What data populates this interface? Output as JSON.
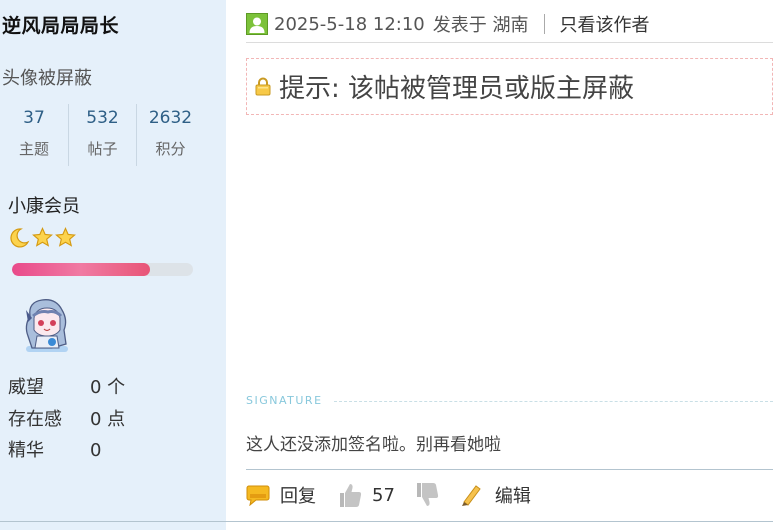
{
  "sidebar": {
    "username": "逆风局局局长",
    "avatar_note": "头像被屏蔽",
    "stats": [
      {
        "value": "37",
        "label": "主题"
      },
      {
        "value": "532",
        "label": "帖子"
      },
      {
        "value": "2632",
        "label": "积分"
      }
    ],
    "group": "小康会员",
    "rank_icons": [
      "moon-icon",
      "star-icon",
      "star-icon"
    ],
    "progress_percent": 76,
    "info": [
      {
        "key": "威望",
        "value": "0 个"
      },
      {
        "key": "存在感",
        "value": "0 点"
      },
      {
        "key": "精华",
        "value": "0"
      }
    ]
  },
  "post": {
    "datetime": "2025-5-18 12:10",
    "posted_in": "发表于 湖南",
    "only_author": "只看该作者",
    "notice": "提示: 该帖被管理员或版主屏蔽",
    "signature_label": "SIGNATURE",
    "signature_text": "这人还没添加签名啦。别再看她啦",
    "actions": {
      "reply": "回复",
      "like_count": "57",
      "edit": "编辑"
    }
  },
  "colors": {
    "sidebar_bg": "#e5f0fa",
    "progress_fill": "#e94a8a",
    "stat_number": "#2e5f86",
    "notice_border": "#f2b6b6"
  }
}
